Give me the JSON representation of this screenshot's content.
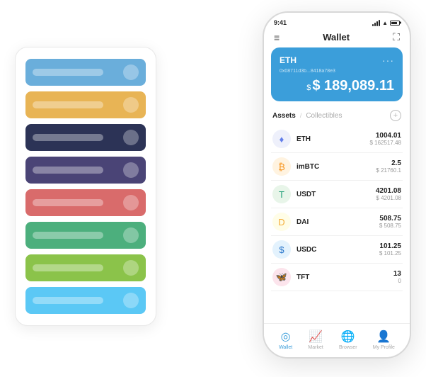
{
  "scene": {
    "phone": {
      "time": "9:41",
      "header": {
        "title": "Wallet"
      },
      "eth_card": {
        "title": "ETH",
        "address": "0x08711d3b...8418a78e3",
        "amount": "$ 189,089.11",
        "dollar_sign": "$"
      },
      "assets": {
        "active_tab": "Assets",
        "inactive_tab": "Collectibles",
        "items": [
          {
            "name": "ETH",
            "amount": "1004.01",
            "usd": "$ 162517.48",
            "color": "#627EEA",
            "symbol": "♦"
          },
          {
            "name": "imBTC",
            "amount": "2.5",
            "usd": "$ 21760.1",
            "color": "#F7931A",
            "symbol": "₿"
          },
          {
            "name": "USDT",
            "amount": "4201.08",
            "usd": "$ 4201.08",
            "color": "#26A17B",
            "symbol": "₮"
          },
          {
            "name": "DAI",
            "amount": "508.75",
            "usd": "$ 508.75",
            "color": "#F5AC37",
            "symbol": "◈"
          },
          {
            "name": "USDC",
            "amount": "101.25",
            "usd": "$ 101.25",
            "color": "#2775CA",
            "symbol": "©"
          },
          {
            "name": "TFT",
            "amount": "13",
            "usd": "0",
            "color": "#E04A6A",
            "symbol": "🦋"
          }
        ]
      },
      "nav": [
        {
          "label": "Wallet",
          "active": true,
          "icon": "👛"
        },
        {
          "label": "Market",
          "active": false,
          "icon": "📊"
        },
        {
          "label": "Browser",
          "active": false,
          "icon": "👤"
        },
        {
          "label": "My Profile",
          "active": false,
          "icon": "👤"
        }
      ]
    },
    "card_stack": {
      "cards": [
        {
          "color": "#6AAEDB"
        },
        {
          "color": "#E8B455"
        },
        {
          "color": "#2C3356"
        },
        {
          "color": "#4A4476"
        },
        {
          "color": "#D96B6B"
        },
        {
          "color": "#4CAF7D"
        },
        {
          "color": "#8BC34A"
        },
        {
          "color": "#5BC8F5"
        }
      ]
    }
  }
}
